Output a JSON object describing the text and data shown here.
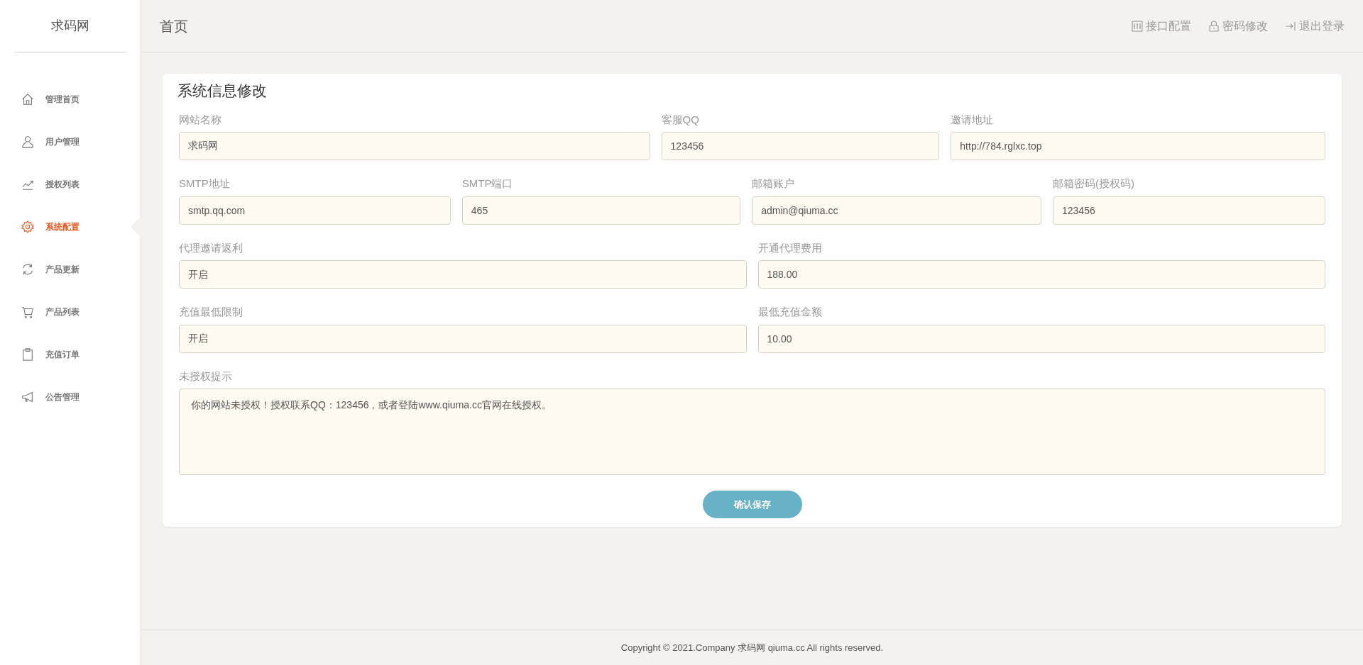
{
  "sidebar": {
    "brand": "求码网",
    "items": [
      {
        "label": "管理首页",
        "selected": false
      },
      {
        "label": "用户管理",
        "selected": false
      },
      {
        "label": "授权列表",
        "selected": false
      },
      {
        "label": "系统配置",
        "selected": true
      },
      {
        "label": "产品更新",
        "selected": false
      },
      {
        "label": "产品列表",
        "selected": false
      },
      {
        "label": "充值订单",
        "selected": false
      },
      {
        "label": "公告管理",
        "selected": false
      }
    ]
  },
  "header": {
    "title": "首页",
    "links": [
      {
        "label": "接口配置"
      },
      {
        "label": "密码修改"
      },
      {
        "label": "退出登录"
      }
    ]
  },
  "form": {
    "title": "系统信息修改",
    "fields": [
      {
        "kind": "input",
        "label": "网站名称",
        "value": "求码网"
      },
      {
        "kind": "input",
        "label": "客服QQ",
        "value": "123456"
      },
      {
        "kind": "input",
        "label": "邀请地址",
        "value": "http://784.rglxc.top"
      },
      {
        "kind": "input",
        "label": "SMTP地址",
        "value": "smtp.qq.com"
      },
      {
        "kind": "input",
        "label": "SMTP端口",
        "value": "465"
      },
      {
        "kind": "input",
        "label": "邮箱账户",
        "value": "admin@qiuma.cc"
      },
      {
        "kind": "input",
        "label": "邮箱密码(授权码)",
        "value": "123456"
      },
      {
        "kind": "select",
        "label": "代理邀请返利",
        "value": "开启"
      },
      {
        "kind": "input",
        "label": "开通代理费用",
        "value": "188.00"
      },
      {
        "kind": "select",
        "label": "充值最低限制",
        "value": "开启"
      },
      {
        "kind": "input",
        "label": "最低充值金额",
        "value": "10.00"
      },
      {
        "kind": "textarea",
        "label": "未授权提示",
        "value": "你的网站未授权！授权联系QQ：123456，或者登陆www.qiuma.cc官网在线授权。"
      }
    ],
    "submit": "确认保存"
  },
  "footer": "Copyright © 2021.Company 求码网 qiuma.cc All rights reserved."
}
